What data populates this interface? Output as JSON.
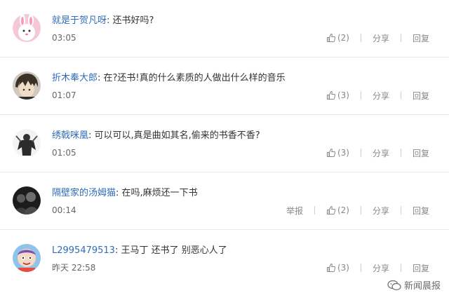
{
  "labels": {
    "separator": ": ",
    "report": "举报",
    "share": "分享",
    "reply": "回复"
  },
  "comments": [
    {
      "username": "就是于贺凡呀",
      "content": "还书好吗?",
      "time": "03:05",
      "likes": "(2)",
      "show_report": false
    },
    {
      "username": "折木奉大郎",
      "content": "在?还书!真的什么素质的人做出什么样的音乐",
      "time": "01:07",
      "likes": "(3)",
      "show_report": false
    },
    {
      "username": "绣戟咪凰",
      "content": "可以可以,真是曲如其名,偷来的书香不香?",
      "time": "01:05",
      "likes": "(3)",
      "show_report": false
    },
    {
      "username": "隔壁家的汤姆猫",
      "content": "在吗,麻烦还一下书",
      "time": "00:14",
      "likes": "(2)",
      "show_report": true
    },
    {
      "username": "L2995479513",
      "content": "王马丁 还书了 别恶心人了",
      "time": "昨天 22:58",
      "likes": "(3)",
      "show_report": false
    }
  ],
  "watermark": {
    "text": "新闻晨报",
    "icon": "wechat-icon"
  },
  "colors": {
    "username": "#2f6cb8",
    "text": "#333333",
    "muted": "#888888",
    "divider": "#e9e9e9"
  }
}
